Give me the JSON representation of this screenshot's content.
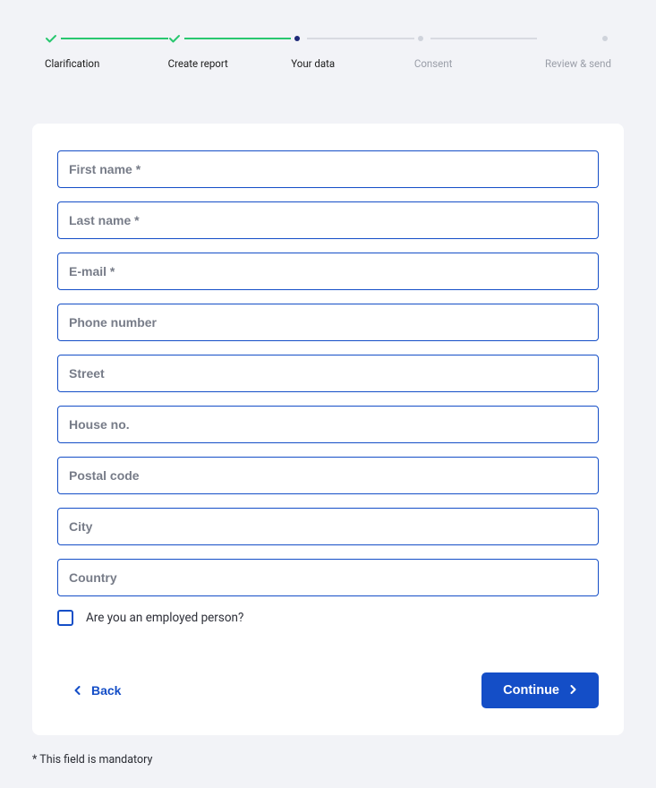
{
  "stepper": {
    "steps": [
      {
        "label": "Clarification",
        "state": "done"
      },
      {
        "label": "Create report",
        "state": "done"
      },
      {
        "label": "Your data",
        "state": "active"
      },
      {
        "label": "Consent",
        "state": "inactive"
      },
      {
        "label": "Review & send",
        "state": "inactive"
      }
    ]
  },
  "form": {
    "fields": {
      "first_name": {
        "placeholder": "First name *",
        "value": ""
      },
      "last_name": {
        "placeholder": "Last name *",
        "value": ""
      },
      "email": {
        "placeholder": "E-mail *",
        "value": ""
      },
      "phone": {
        "placeholder": "Phone number",
        "value": ""
      },
      "street": {
        "placeholder": "Street",
        "value": ""
      },
      "house_no": {
        "placeholder": "House no.",
        "value": ""
      },
      "postal_code": {
        "placeholder": "Postal code",
        "value": ""
      },
      "city": {
        "placeholder": "City",
        "value": ""
      },
      "country": {
        "placeholder": "Country",
        "value": ""
      }
    },
    "checkbox": {
      "label": "Are you an employed person?",
      "checked": false
    }
  },
  "buttons": {
    "back": "Back",
    "continue": "Continue"
  },
  "footer": {
    "mandatory_note": "* This field is mandatory"
  }
}
